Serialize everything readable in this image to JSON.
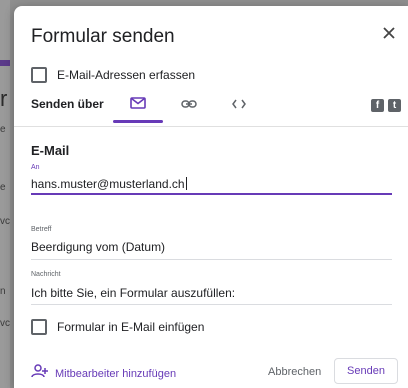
{
  "background": {
    "glyphs": [
      "r",
      "e",
      "e",
      "vc",
      "n",
      "vc"
    ]
  },
  "dialog": {
    "title": "Formular senden",
    "close_icon": "close-icon",
    "collect_emails_label": "E-Mail-Adressen erfassen",
    "collect_emails_checked": false,
    "send_via_label": "Senden über",
    "tabs": [
      {
        "name": "email",
        "icon": "email-icon",
        "active": true
      },
      {
        "name": "link",
        "icon": "link-icon",
        "active": false
      },
      {
        "name": "embed",
        "icon": "embed-icon",
        "active": false
      }
    ],
    "social": [
      {
        "name": "facebook",
        "glyph": "f"
      },
      {
        "name": "twitter",
        "glyph": "t"
      }
    ],
    "section_title": "E-Mail",
    "to_label": "An",
    "to_value": "hans.muster@musterland.ch",
    "subject_label": "Betreff",
    "subject_value": "Beerdigung vom (Datum)",
    "message_label": "Nachricht",
    "message_value": "Ich bitte Sie, ein Formular auszufüllen:",
    "include_form_label": "Formular in E-Mail einfügen",
    "include_form_checked": false,
    "add_collaborators_label": "Mitbearbeiter hinzufügen",
    "cancel_label": "Abbrechen",
    "send_label": "Senden",
    "accent_color": "#673ab7"
  }
}
